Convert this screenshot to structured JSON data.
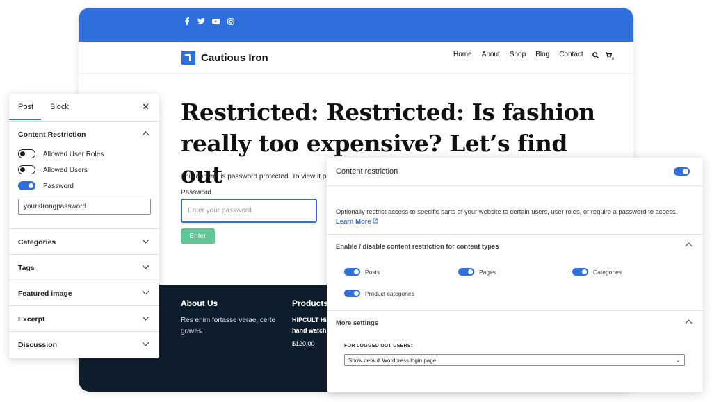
{
  "site": {
    "brand": "Cautious Iron",
    "social_icons": [
      "facebook-icon",
      "twitter-icon",
      "youtube-icon",
      "instagram-icon"
    ],
    "nav": [
      "Home",
      "About",
      "Shop",
      "Blog",
      "Contact"
    ],
    "cart_count": "0",
    "headline": "Restricted: Restricted: Is fashion really too expensive? Let’s find out",
    "protected_text": "This content is password protected. To view it pl",
    "password_label": "Password",
    "password_placeholder": "Enter your password",
    "enter_label": "Enter",
    "footer": {
      "about_title": "About Us",
      "about_text": "Res enim fortasse verae, certe graves.",
      "products_title": "Products",
      "product_name": "HIPCULT Hip hand watch",
      "product_price": "$120.00"
    },
    "colors": {
      "accent": "#2f6fdb",
      "footer_bg": "#0f1e2d",
      "enter_button": "#5fc796"
    }
  },
  "sidebar": {
    "tabs": [
      "Post",
      "Block"
    ],
    "section_title": "Content Restriction",
    "toggles": [
      {
        "label": "Allowed User Roles",
        "on": false
      },
      {
        "label": "Allowed Users",
        "on": false
      },
      {
        "label": "Password",
        "on": true
      }
    ],
    "password_value": "yourstrongpassword",
    "collapsed_sections": [
      "Categories",
      "Tags",
      "Featured image",
      "Excerpt",
      "Discussion"
    ]
  },
  "settings": {
    "title": "Content restriction",
    "description": "Optionally restrict access to specific parts of your website to certain users, user roles, or require a password to access.",
    "learn_more": "Learn More",
    "content_types_title": "Enable / disable content restriction for content types",
    "content_types": [
      "Posts",
      "Pages",
      "Categories",
      "Product categories"
    ],
    "more_settings": "More settings",
    "logged_out_label": "FOR LOGGED OUT USERS:",
    "logged_out_value": "Show default Wordpress login page"
  }
}
